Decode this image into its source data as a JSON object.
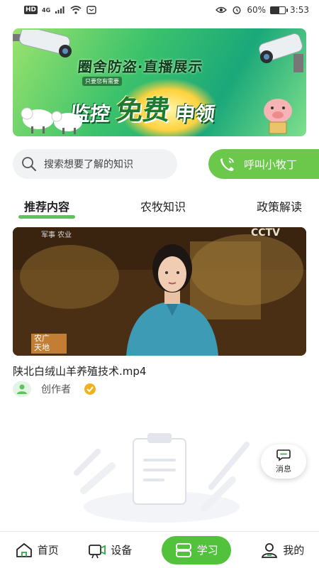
{
  "status_bar": {
    "network": "HD",
    "signal_type": "4G",
    "battery_percent": "60%",
    "battery_level": 0.6,
    "time": "3:53"
  },
  "banner": {
    "headline": "圈舍防盗·直播展示",
    "tag": "只要您有需要",
    "main_left": "监控",
    "main_center": "免费",
    "main_right": "申领"
  },
  "search": {
    "placeholder": "搜索想要了解的知识",
    "icon": "search-icon"
  },
  "call_button": {
    "label": "呼叫小牧丁",
    "icon": "phone-icon"
  },
  "tabs": [
    {
      "label": "推荐内容",
      "active": true
    },
    {
      "label": "农牧知识",
      "active": false
    },
    {
      "label": "政策解读",
      "active": false
    }
  ],
  "video": {
    "title": "陕北白绒山羊养殖技术.mp4",
    "author": "创作者",
    "overlay_channel": "CCTV",
    "overlay_logo_lines": [
      "农广",
      "天地"
    ],
    "overlay_top_text": "军事 农业"
  },
  "floating_message": {
    "label": "消息",
    "icon": "message-icon"
  },
  "bottom_nav": [
    {
      "label": "首页",
      "icon": "home-icon",
      "active": false
    },
    {
      "label": "设备",
      "icon": "camera-icon",
      "active": false
    },
    {
      "label": "学习",
      "icon": "learn-icon",
      "active": true
    },
    {
      "label": "我的",
      "icon": "user-icon",
      "active": false
    }
  ],
  "colors": {
    "accent_green": "#52c13c",
    "call_green": "#6bc84a",
    "tab_underline": "#5dc45a"
  }
}
